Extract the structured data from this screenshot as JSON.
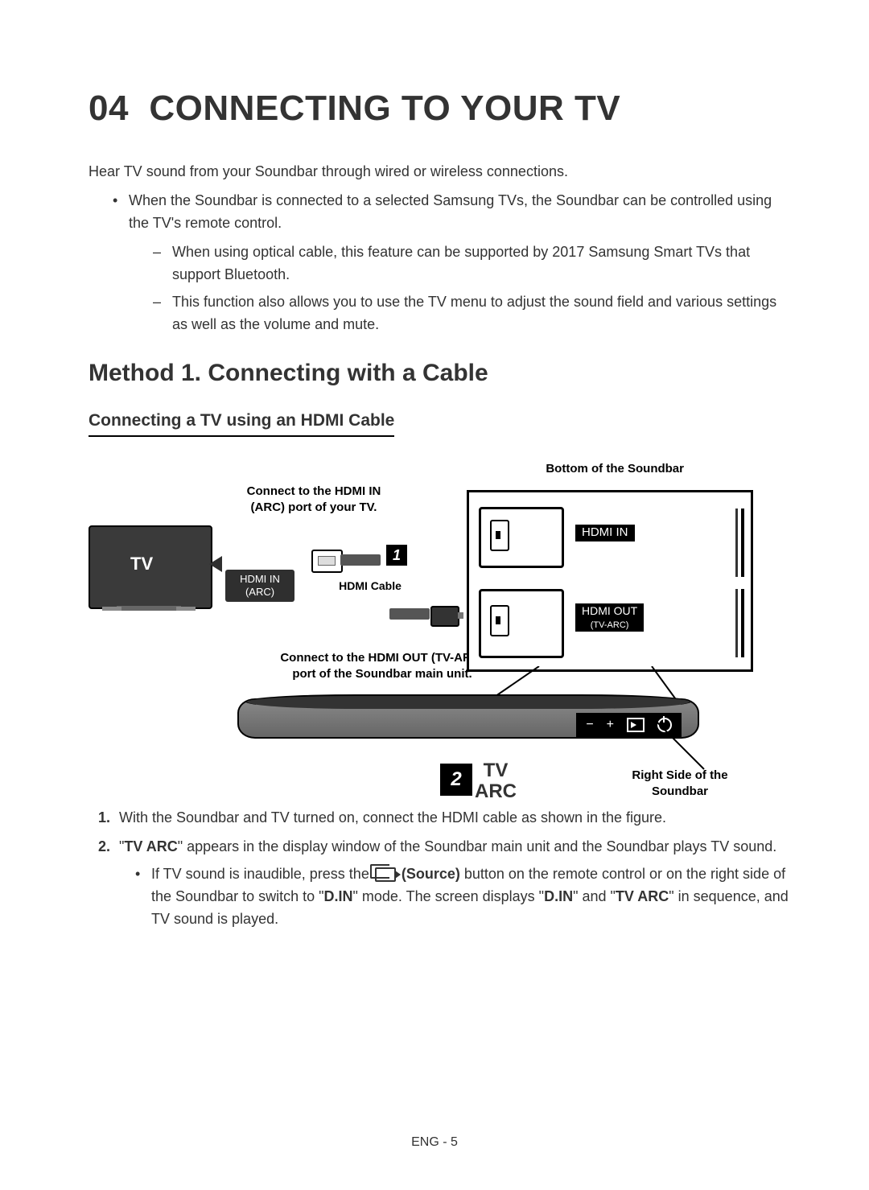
{
  "chapter_no": "04",
  "chapter_title": "CONNECTING TO YOUR TV",
  "intro": "Hear TV sound from your Soundbar through wired or wireless connections.",
  "bullets": [
    "When the Soundbar is connected to a selected Samsung TVs, the Soundbar can be controlled using the TV's remote control."
  ],
  "dashes": [
    "When using optical cable, this feature can be supported by 2017 Samsung Smart TVs that support Bluetooth.",
    "This function also allows you to use the TV menu to adjust the sound field and various settings as well as the volume and mute."
  ],
  "h2": "Method 1. Connecting with a Cable",
  "h3": "Connecting a TV using an HDMI Cable",
  "diagram": {
    "top_label": "Bottom of the Soundbar",
    "tv_connect_l1": "Connect to the HDMI IN",
    "tv_connect_l2": "(ARC) port of your TV.",
    "tv_text": "TV",
    "tv_port_l1": "HDMI IN",
    "tv_port_l2": "(ARC)",
    "cable_label": "HDMI Cable",
    "sb_connect_l1": "Connect to the HDMI OUT (TV-ARC)",
    "sb_connect_l2": "port of the Soundbar main unit.",
    "port_in": "HDMI IN",
    "port_out_l1": "HDMI OUT",
    "port_out_l2": "(TV-ARC)",
    "right_side_l1": "Right Side of the",
    "right_side_l2": "Soundbar",
    "step1": "1",
    "step2": "2",
    "tvarc_l1": "TV",
    "tvarc_l2": "ARC",
    "minus": "−",
    "plus": "+"
  },
  "steps": [
    {
      "text": "With the Soundbar and TV turned on, connect the HDMI cable as shown in the figure."
    },
    {
      "parts": [
        "\"",
        "TV ARC",
        "\" appears in the display window of the Soundbar main unit and the Soundbar plays TV sound."
      ],
      "sub": {
        "pre": "If TV sound is inaudible, press the ",
        "src_bold": " (Source)",
        "mid1": " button on the remote control or on the right side of the Soundbar to switch to \"",
        "din1": "D.IN",
        "mid2": "\" mode. The screen displays \"",
        "din2": "D.IN",
        "mid3": "\" and \"",
        "tvarc": "TV ARC",
        "post": "\" in sequence, and TV sound is played."
      }
    }
  ],
  "footer": "ENG - 5"
}
